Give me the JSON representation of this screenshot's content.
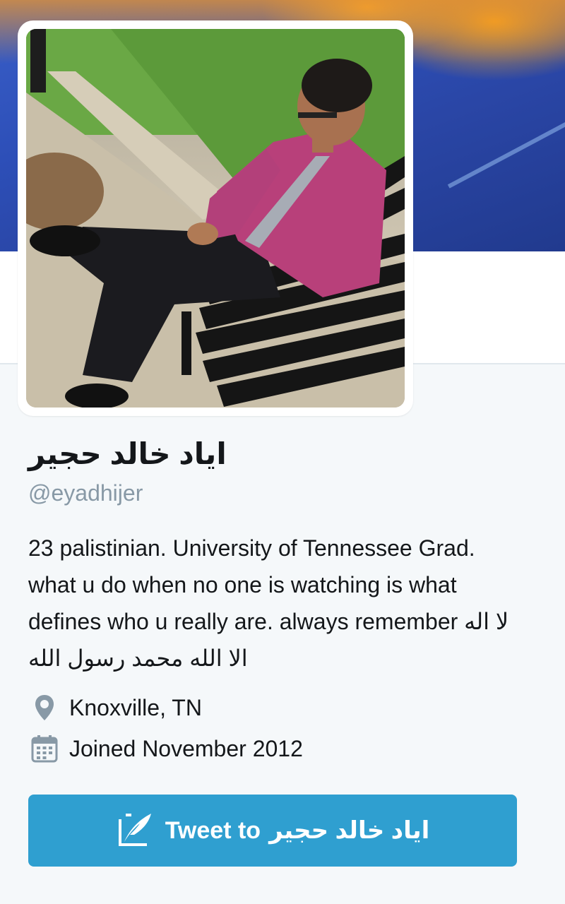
{
  "profile": {
    "display_name": "اياد خالد حجير",
    "handle": "@eyadhijer",
    "bio": "23 palistinian. University of Tennessee Grad. what u do when no one is watching is what defines who u really are. always remember لا اله الا الله محمد رسول الله",
    "location": "Knoxville, TN",
    "joined": "Joined November 2012"
  },
  "tweet_button": {
    "prefix": "Tweet to",
    "recipient": "اياد خالد حجير"
  },
  "icons": {
    "location": "location-pin-icon",
    "joined": "calendar-icon",
    "tweet": "compose-tweet-icon"
  },
  "colors": {
    "accent": "#2f9fd0",
    "handle": "#8899a6",
    "background": "#f5f8fa"
  }
}
